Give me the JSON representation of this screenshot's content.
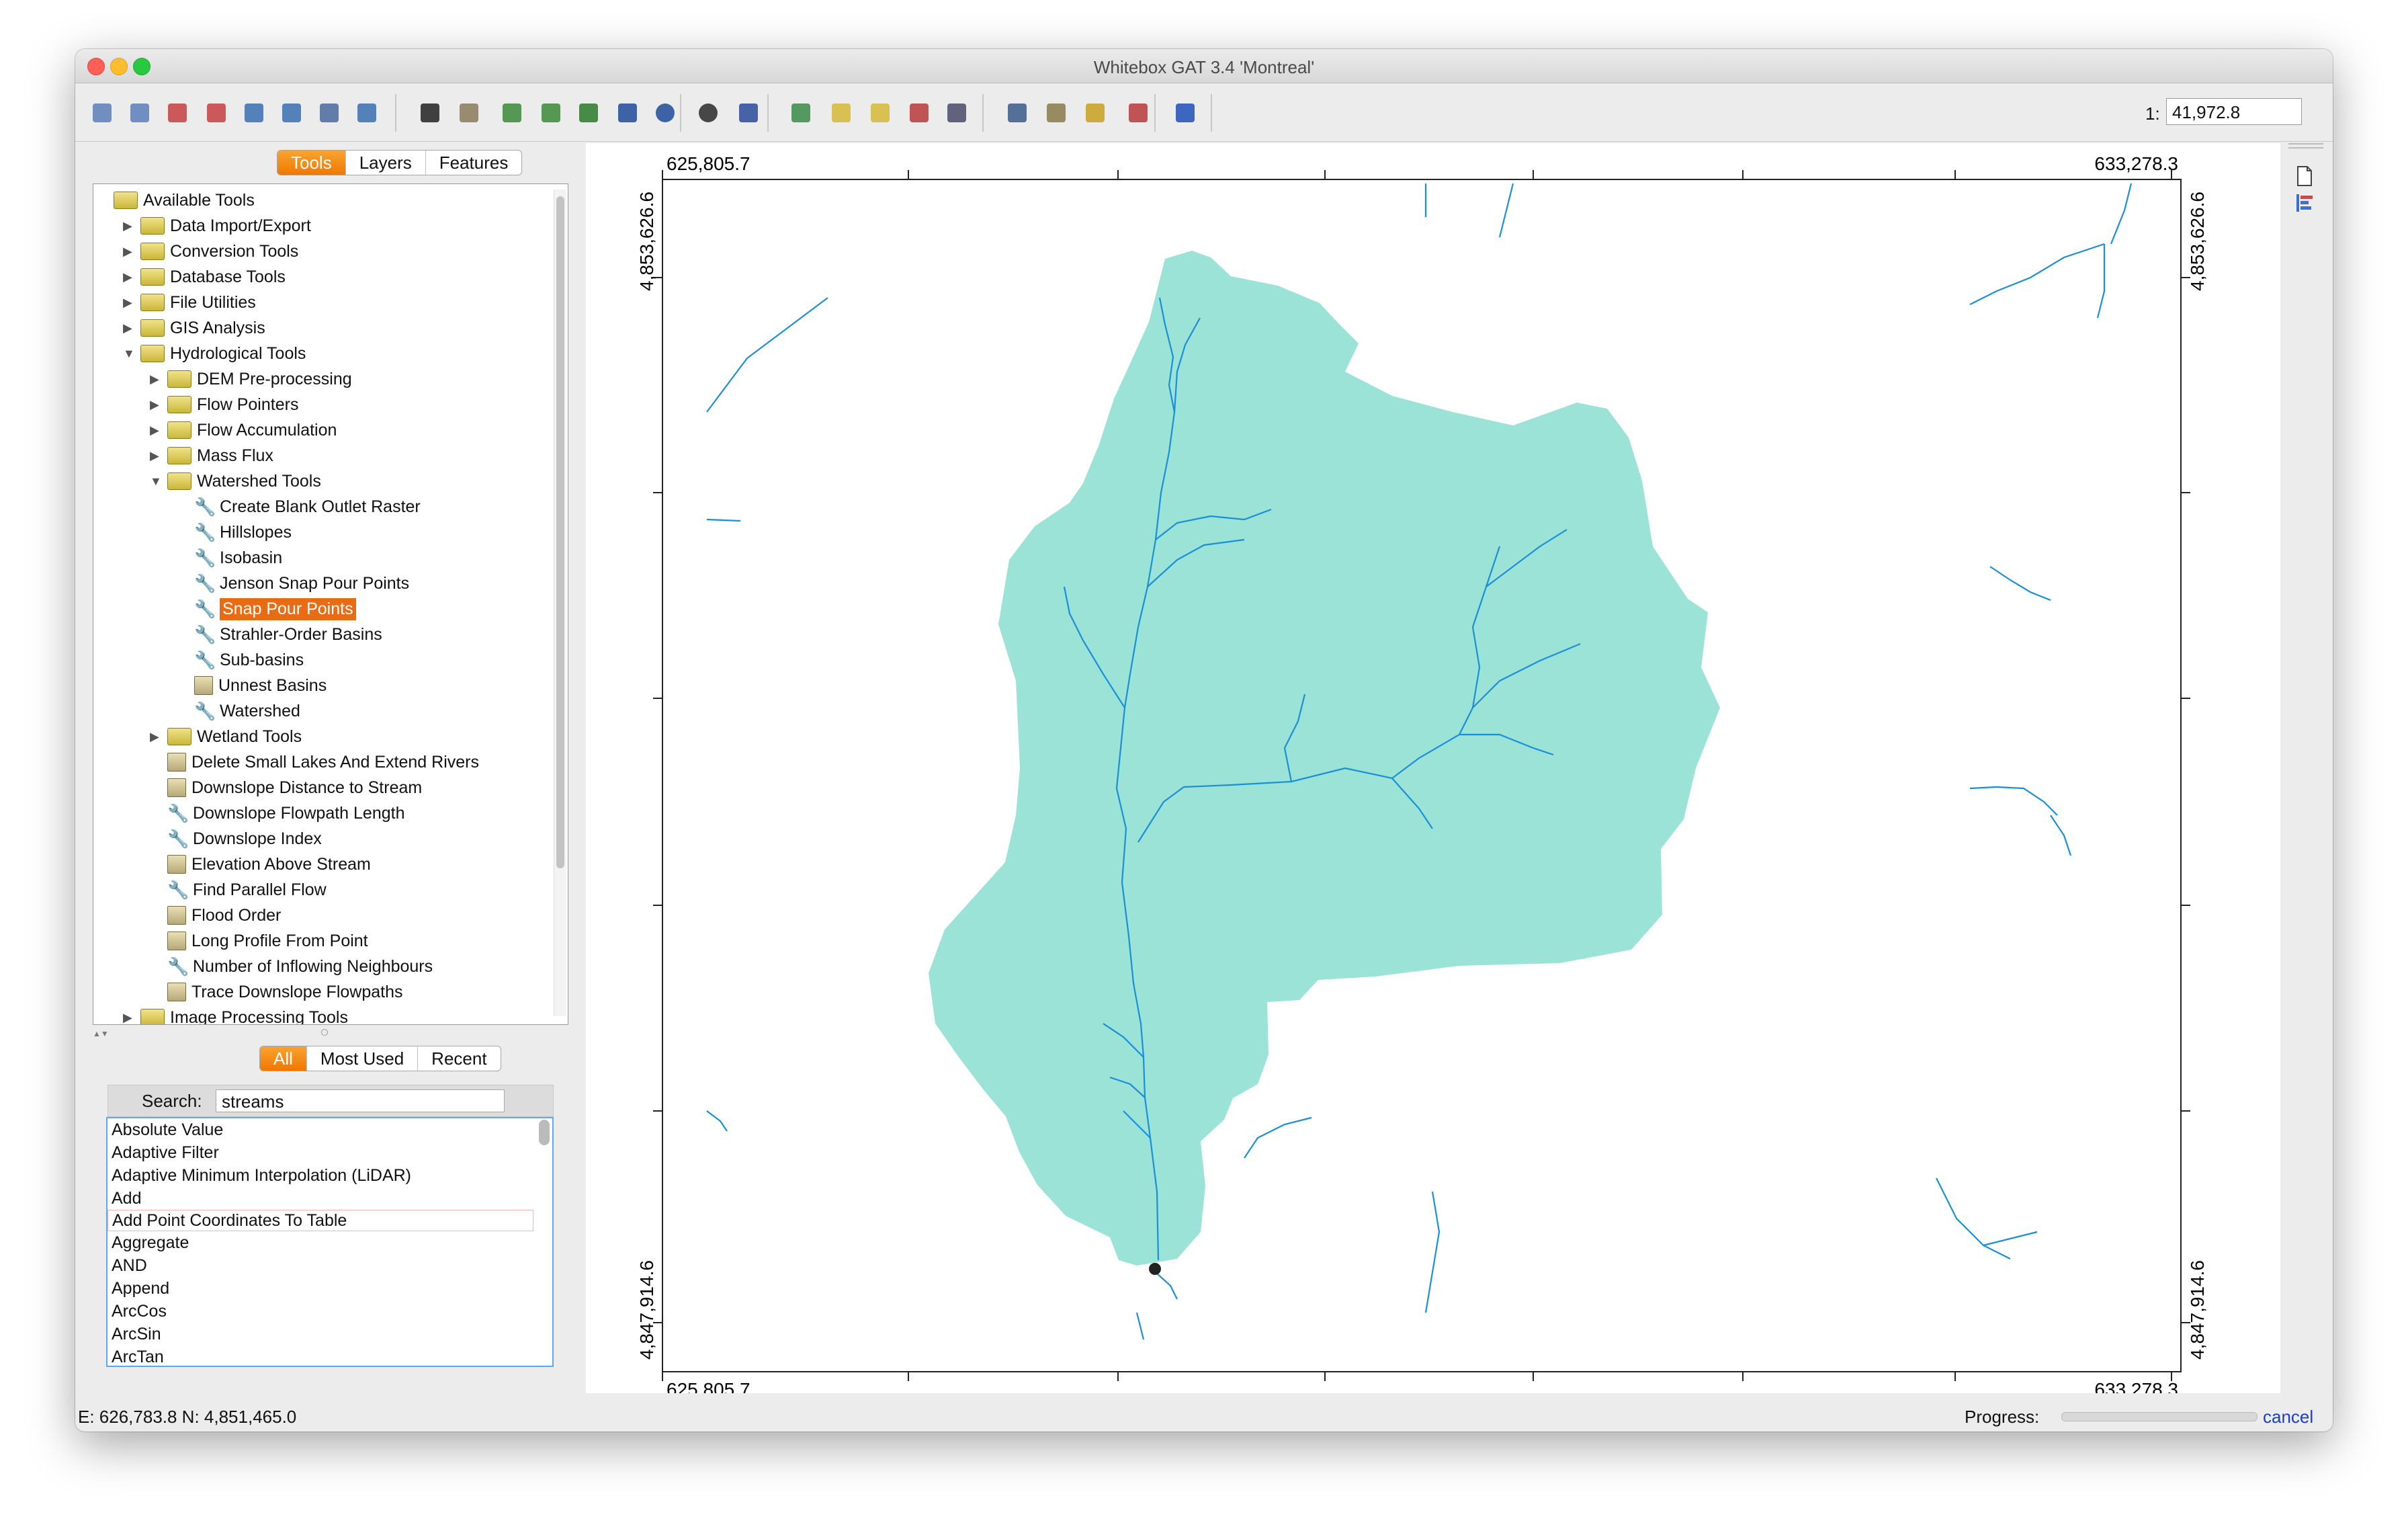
{
  "window": {
    "title": "Whitebox GAT 3.4 'Montreal'"
  },
  "toolbar": {
    "scale_label": "1:",
    "scale_value": "41,972.8",
    "buttons": [
      "open-raster",
      "open-vector",
      "close-layer",
      "close-all-layers",
      "layer-list",
      "layer-props",
      "palette-manager",
      "map-properties",
      "select",
      "pan",
      "zoom-in",
      "zoom-out",
      "full-extent",
      "previous-extent",
      "next-extent",
      "select-feature",
      "zoom-to-feature",
      "new-map",
      "open-map",
      "open-folder",
      "save-map",
      "print-map",
      "calculator",
      "scripter",
      "measure",
      "profile",
      "help"
    ]
  },
  "panel": {
    "tabs": [
      "Tools",
      "Layers",
      "Features"
    ],
    "active_tab": "Tools",
    "tree": [
      {
        "label": "Available Tools",
        "icon": "folder",
        "depth": 0,
        "arrow": ""
      },
      {
        "label": "Data Import/Export",
        "icon": "folder",
        "depth": 1,
        "arrow": "▶"
      },
      {
        "label": "Conversion Tools",
        "icon": "folder",
        "depth": 1,
        "arrow": "▶"
      },
      {
        "label": "Database Tools",
        "icon": "folder",
        "depth": 1,
        "arrow": "▶"
      },
      {
        "label": "File Utilities",
        "icon": "folder",
        "depth": 1,
        "arrow": "▶"
      },
      {
        "label": "GIS Analysis",
        "icon": "folder",
        "depth": 1,
        "arrow": "▶"
      },
      {
        "label": "Hydrological Tools",
        "icon": "folder",
        "depth": 1,
        "arrow": "▼"
      },
      {
        "label": "DEM Pre-processing",
        "icon": "folder",
        "depth": 2,
        "arrow": "▶"
      },
      {
        "label": "Flow Pointers",
        "icon": "folder",
        "depth": 2,
        "arrow": "▶"
      },
      {
        "label": "Flow Accumulation",
        "icon": "folder",
        "depth": 2,
        "arrow": "▶"
      },
      {
        "label": "Mass Flux",
        "icon": "folder",
        "depth": 2,
        "arrow": "▶"
      },
      {
        "label": "Watershed Tools",
        "icon": "folder",
        "depth": 2,
        "arrow": "▼"
      },
      {
        "label": "Create Blank Outlet Raster",
        "icon": "wrench",
        "depth": 3,
        "arrow": ""
      },
      {
        "label": "Hillslopes",
        "icon": "wrench",
        "depth": 3,
        "arrow": ""
      },
      {
        "label": "Isobasin",
        "icon": "wrench",
        "depth": 3,
        "arrow": ""
      },
      {
        "label": "Jenson Snap Pour Points",
        "icon": "wrench",
        "depth": 3,
        "arrow": ""
      },
      {
        "label": "Snap Pour Points",
        "icon": "wrench",
        "depth": 3,
        "arrow": "",
        "selected": true
      },
      {
        "label": "Strahler-Order Basins",
        "icon": "wrench",
        "depth": 3,
        "arrow": ""
      },
      {
        "label": "Sub-basins",
        "icon": "wrench",
        "depth": 3,
        "arrow": ""
      },
      {
        "label": "Unnest Basins",
        "icon": "script",
        "depth": 3,
        "arrow": ""
      },
      {
        "label": "Watershed",
        "icon": "wrench",
        "depth": 3,
        "arrow": ""
      },
      {
        "label": "Wetland Tools",
        "icon": "folder",
        "depth": 2,
        "arrow": "▶"
      },
      {
        "label": "Delete Small Lakes And Extend Rivers",
        "icon": "script",
        "depth": 2,
        "arrow": ""
      },
      {
        "label": "Downslope Distance to Stream",
        "icon": "script",
        "depth": 2,
        "arrow": ""
      },
      {
        "label": "Downslope Flowpath Length",
        "icon": "wrench",
        "depth": 2,
        "arrow": ""
      },
      {
        "label": "Downslope Index",
        "icon": "wrench",
        "depth": 2,
        "arrow": ""
      },
      {
        "label": "Elevation Above Stream",
        "icon": "script",
        "depth": 2,
        "arrow": ""
      },
      {
        "label": "Find Parallel Flow",
        "icon": "wrench",
        "depth": 2,
        "arrow": ""
      },
      {
        "label": "Flood Order",
        "icon": "script",
        "depth": 2,
        "arrow": ""
      },
      {
        "label": "Long Profile From Point",
        "icon": "script",
        "depth": 2,
        "arrow": ""
      },
      {
        "label": "Number of Inflowing Neighbours",
        "icon": "wrench",
        "depth": 2,
        "arrow": ""
      },
      {
        "label": "Trace Downslope Flowpaths",
        "icon": "script",
        "depth": 2,
        "arrow": ""
      },
      {
        "label": "Image Processing Tools",
        "icon": "folder",
        "depth": 1,
        "arrow": "▶"
      }
    ],
    "list_tabs": [
      "All",
      "Most Used",
      "Recent"
    ],
    "active_list_tab": "All",
    "search_label": "Search:",
    "search_value": "streams",
    "tool_list": [
      "Absolute Value",
      "Adaptive Filter",
      "Adaptive Minimum Interpolation (LiDAR)",
      "Add",
      "Add Point Coordinates To Table",
      "Aggregate",
      "AND",
      "Append",
      "ArcCos",
      "ArcSin",
      "ArcTan"
    ],
    "highlighted_tool": "Add Point Coordinates To Table"
  },
  "map": {
    "x_min_label": "625,805.7",
    "x_max_label": "633,278.3",
    "y_max_label": "4,853,626.6",
    "y_min_label": "4,847,914.6",
    "watershed_color": "#9be3d6",
    "stream_color": "#1a8fd8"
  },
  "status": {
    "coords": "E: 626,783.8  N: 4,851,465.0",
    "progress_label": "Progress:",
    "progress_value": 0,
    "cancel_label": "cancel"
  }
}
